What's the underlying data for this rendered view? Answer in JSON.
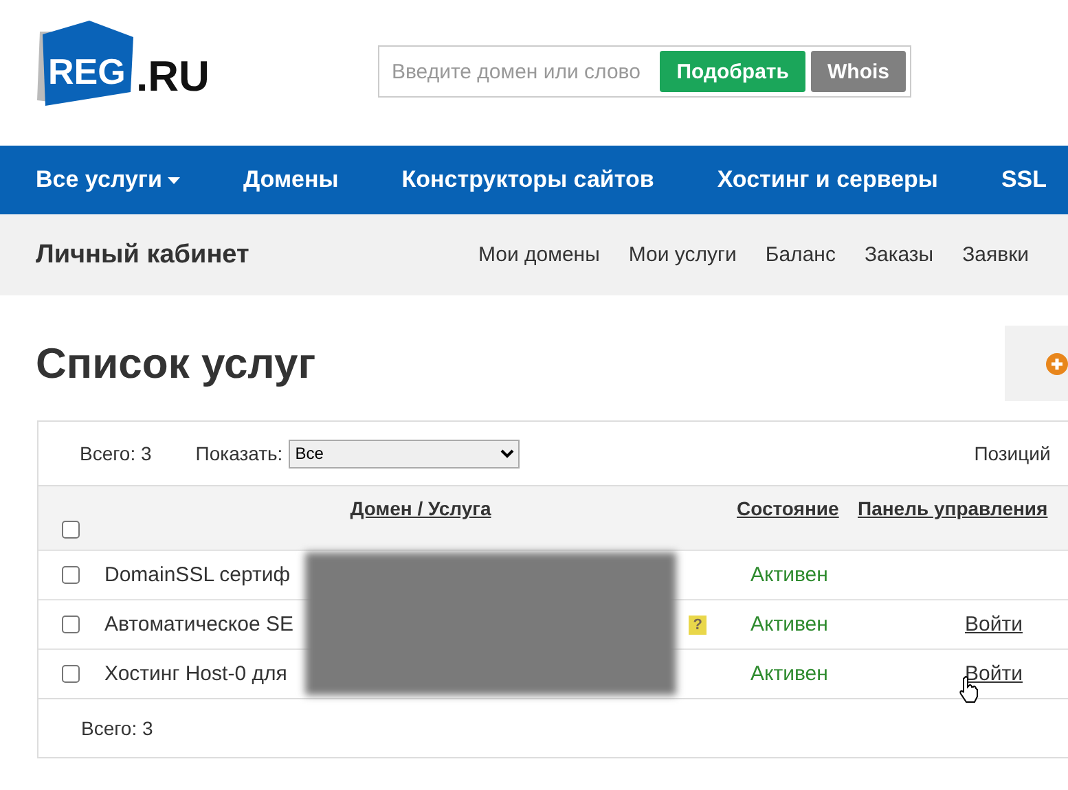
{
  "logo": {
    "text": "REG",
    "suffix": ".RU"
  },
  "search": {
    "placeholder": "Введите домен или слово",
    "buttons": [
      {
        "label": "Подобрать",
        "kind": "primary"
      },
      {
        "label": "Whois",
        "kind": "secondary"
      }
    ]
  },
  "main_nav": [
    {
      "label": "Все услуги",
      "dropdown": true
    },
    {
      "label": "Домены",
      "dropdown": false
    },
    {
      "label": "Конструкторы сайтов",
      "dropdown": false
    },
    {
      "label": "Хостинг и серверы",
      "dropdown": false
    },
    {
      "label": "SSL",
      "dropdown": false
    }
  ],
  "cabinet": {
    "title": "Личный кабинет",
    "links": [
      "Мои домены",
      "Мои услуги",
      "Баланс",
      "Заказы",
      "Заявки"
    ]
  },
  "page_title": "Список услуг",
  "toolbar": {
    "total": "Всего: 3",
    "show_label": "Показать:",
    "show_value": "Все",
    "positions": "Позиций"
  },
  "table": {
    "columns": [
      "Домен / Услуга",
      "Состояние",
      "Панель управления"
    ],
    "select_all_checked": false,
    "rows": [
      {
        "name": "DomainSSL сертиф",
        "status": "Активен",
        "checked": false,
        "help": null,
        "action": null
      },
      {
        "name": "Автоматическое SE",
        "status": "Активен",
        "checked": false,
        "help": "?",
        "action": "Войти"
      },
      {
        "name": "Хостинг Host-0 для",
        "status": "Активен",
        "checked": false,
        "help": null,
        "action": "Войти"
      }
    ],
    "footer": "Всего: 3"
  }
}
